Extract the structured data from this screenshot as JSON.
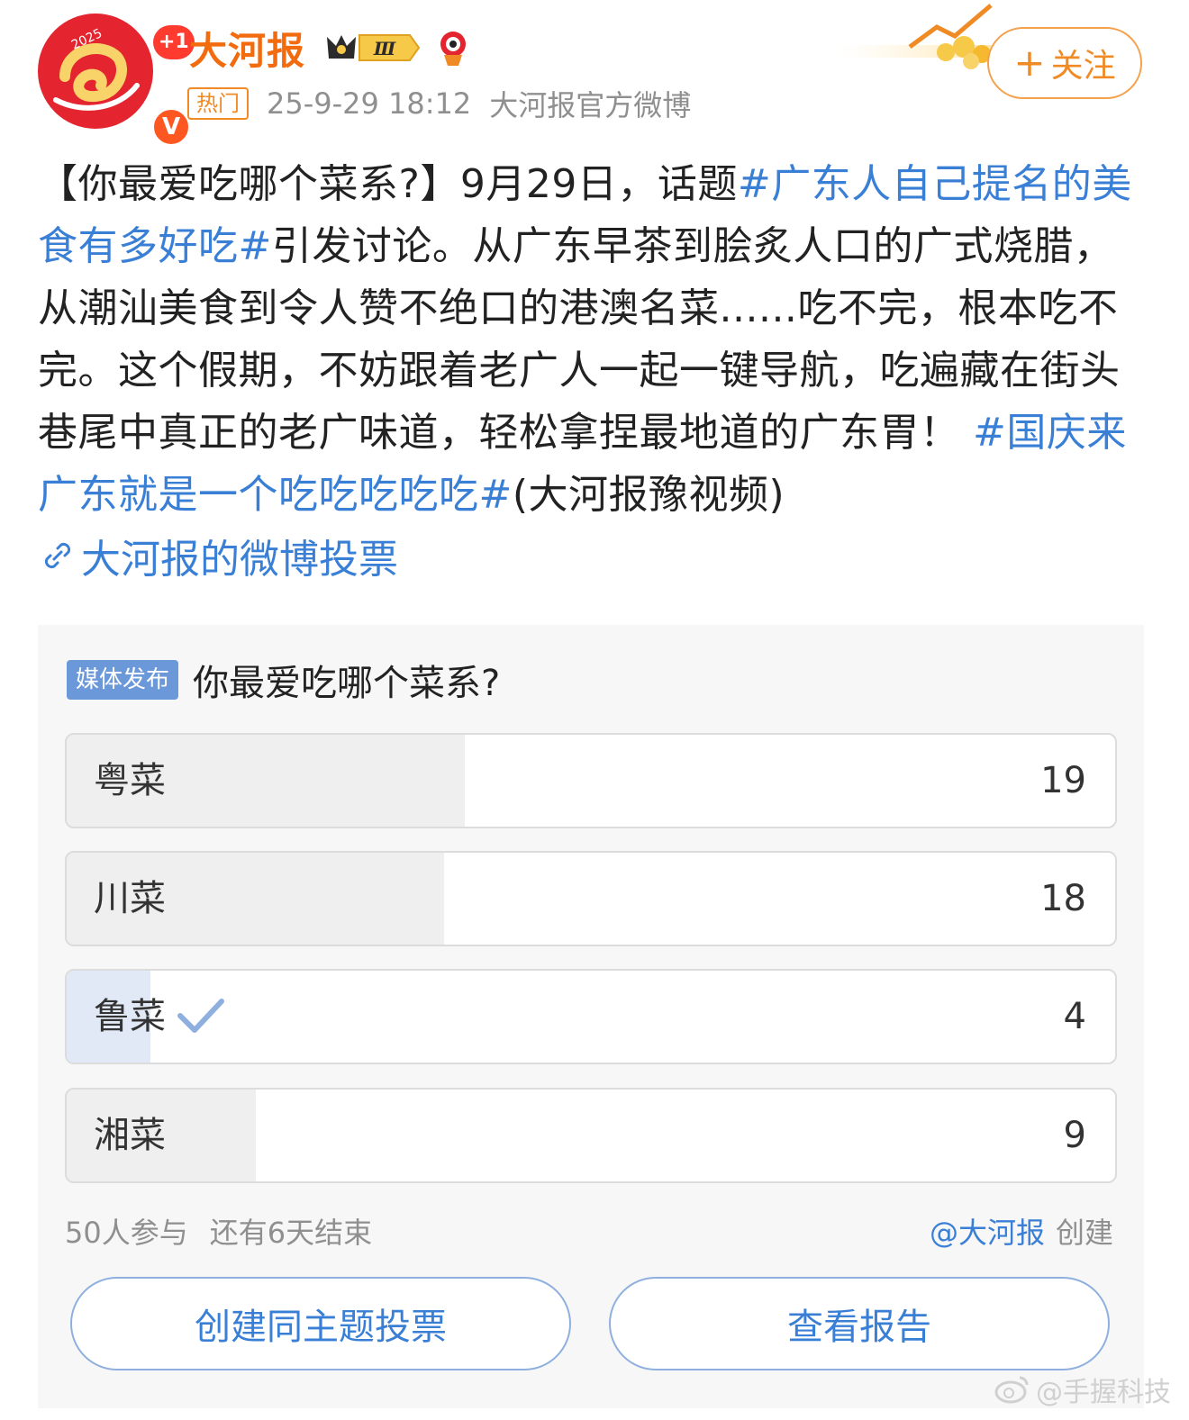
{
  "header": {
    "author": "大河报",
    "avatar_year": "2025",
    "plus_badge": "+1",
    "verified_badge": "V",
    "level_badge": "Ⅲ",
    "hot_tag": "热门",
    "timestamp": "25-9-29 18:12",
    "source": "大河报官方微博",
    "follow": "关注"
  },
  "post": {
    "p1": "【你最爱吃哪个菜系?】9月29日，话题",
    "tag1": "#广东人自己提名的美食有多好吃#",
    "p2": "引发讨论。从广东早茶到脍炙人口的广式烧腊，从潮汕美食到令人赞不绝口的港澳名菜......吃不完，根本吃不完。这个假期，不妨跟着老广人一起一键导航，吃遍藏在街头巷尾中真正的老广味道，轻松拿捏最地道的广东胃！",
    "tag2": "#国庆来广东就是一个吃吃吃吃吃#",
    "p3": "(大河报豫视频)",
    "vote_link": "大河报的微博投票"
  },
  "poll": {
    "media_tag": "媒体发布",
    "title": "你最爱吃哪个菜系?",
    "options": [
      {
        "label": "粤菜",
        "count": "19",
        "share": 0.38,
        "selected": false
      },
      {
        "label": "川菜",
        "count": "18",
        "share": 0.36,
        "selected": false
      },
      {
        "label": "鲁菜",
        "count": "4",
        "share": 0.08,
        "selected": true
      },
      {
        "label": "湘菜",
        "count": "9",
        "share": 0.18,
        "selected": false
      }
    ],
    "participants": "50人参与",
    "remaining": "还有6天结束",
    "creator": "@大河报",
    "created": "创建",
    "btn_create": "创建同主题投票",
    "btn_report": "查看报告"
  },
  "watermark": "@手握科技",
  "colors": {
    "brand_orange": "#f08a24",
    "link_blue": "#3a7fd6",
    "selected_fill": "#e2e9f6"
  }
}
